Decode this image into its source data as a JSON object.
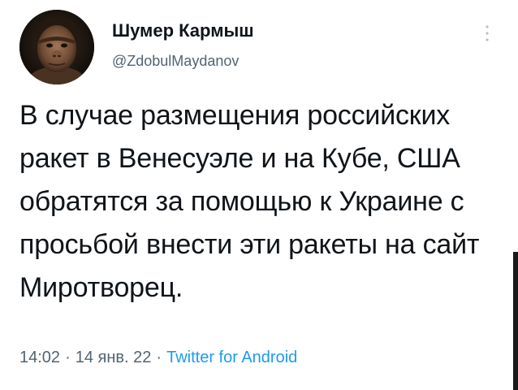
{
  "author": {
    "display_name": "Шумер Кармыш",
    "handle": "@ZdobulMaydanov",
    "avatar_icon": "caveman-avatar"
  },
  "tweet": {
    "text": "В случае размещения российских ракет в Венесуэле и на Кубе, США обратятся за помощью к Украине с просьбой внести эти ракеты на сайт Миротворец."
  },
  "meta": {
    "time": "14:02",
    "date": "14 янв. 22",
    "separator": "·",
    "source": "Twitter for Android"
  },
  "colors": {
    "text": "#0f1419",
    "secondary": "#536471",
    "link": "#1d9bf0"
  }
}
